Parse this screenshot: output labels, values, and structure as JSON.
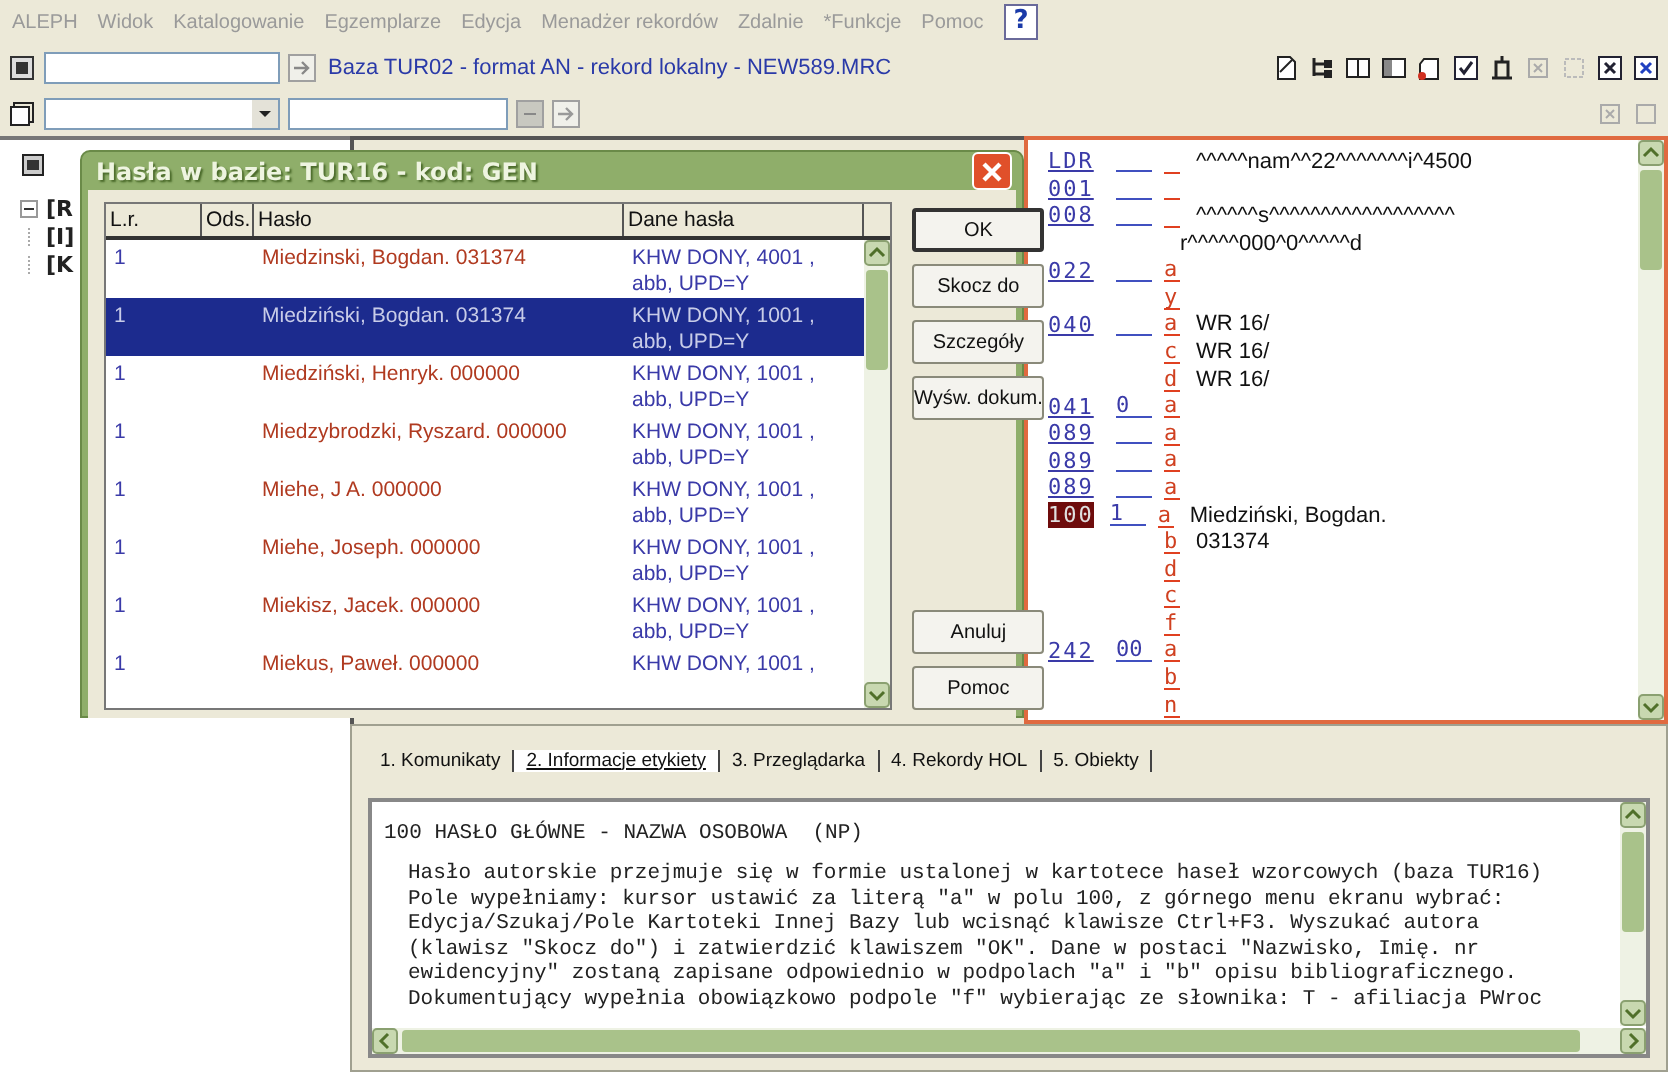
{
  "menu": [
    {
      "label": "ALEPH"
    },
    {
      "label": "Widok"
    },
    {
      "label": "Katalogowanie"
    },
    {
      "label": "Egzemplarze"
    },
    {
      "label": "Edycja"
    },
    {
      "label": "Menadżer rekordów"
    },
    {
      "label": "Zdalnie"
    },
    {
      "label": "*Funkcje"
    },
    {
      "label": "Pomoc"
    }
  ],
  "help_button": "?",
  "toolbar": {
    "title": "Baza TUR02 - format AN - rekord lokalny - NEW589.MRC"
  },
  "tree": {
    "items": [
      {
        "label": "[R",
        "expanded": true
      },
      {
        "label": "[I]",
        "expanded": false
      },
      {
        "label": "[K",
        "expanded": false
      }
    ]
  },
  "dialog": {
    "title": "Hasła w bazie: TUR16 - kod: GEN",
    "columns": [
      "L.r.",
      "Ods.",
      "Hasło",
      "Dane hasła"
    ],
    "rows": [
      {
        "number": "1",
        "heading": "Miedzinski, Bogdan. 031374",
        "data": [
          "KHW DONY, 4001 ,",
          "abb, UPD=Y"
        ],
        "selected": false
      },
      {
        "number": "1",
        "heading": "Miedziński, Bogdan. 031374",
        "data": [
          "KHW DONY, 1001 ,",
          "abb, UPD=Y"
        ],
        "selected": true
      },
      {
        "number": "1",
        "heading": "Miedziński, Henryk. 000000",
        "data": [
          "KHW DONY, 1001 ,",
          "abb, UPD=Y"
        ],
        "selected": false
      },
      {
        "number": "1",
        "heading": "Miedzybrodzki, Ryszard. 000000",
        "data": [
          "KHW DONY, 1001 ,",
          "abb, UPD=Y"
        ],
        "selected": false
      },
      {
        "number": "1",
        "heading": "Miehe, J A. 000000",
        "data": [
          "KHW DONY, 1001 ,",
          "abb, UPD=Y"
        ],
        "selected": false
      },
      {
        "number": "1",
        "heading": "Miehe, Joseph. 000000",
        "data": [
          "KHW DONY, 1001 ,",
          "abb, UPD=Y"
        ],
        "selected": false
      },
      {
        "number": "1",
        "heading": "Miekisz, Jacek. 000000",
        "data": [
          "KHW DONY, 1001 ,",
          "abb, UPD=Y"
        ],
        "selected": false
      },
      {
        "number": "1",
        "heading": "Miekus, Paweł. 000000",
        "data": [
          "KHW DONY, 1001 ,"
        ],
        "selected": false
      }
    ],
    "buttons": [
      "OK",
      "Skocz do",
      "Szczegóły",
      "Wyśw. dokum."
    ],
    "bottom_buttons": [
      "Anuluj",
      "Pomoc"
    ]
  },
  "record": {
    "fields": [
      {
        "tag": "LDR",
        "selected": false,
        "subfields": [
          {
            "text": "^^^^^nam^^22^^^^^^^i^4500"
          }
        ]
      },
      {
        "tag": "001",
        "selected": false
      },
      {
        "tag": "008",
        "selected": false,
        "subfields": [
          {
            "text": "^^^^^^s^^^^^^^^^^^^^^^^^^"
          },
          {
            "text": "r^^^^^000^0^^^^^d",
            "continued": true
          }
        ]
      },
      {
        "tag": "022",
        "selected": false,
        "subfields": [
          {
            "code": "a"
          },
          {
            "code": "y"
          }
        ]
      },
      {
        "tag": "040",
        "selected": false,
        "subfields": [
          {
            "code": "a",
            "text": "WR 16/"
          },
          {
            "code": "c",
            "text": "WR 16/"
          },
          {
            "code": "d",
            "text": "WR 16/"
          }
        ]
      },
      {
        "tag": "041",
        "indicator": "0",
        "selected": false,
        "subfields": [
          {
            "code": "a"
          }
        ]
      },
      {
        "tag": "089",
        "selected": false,
        "subfields": [
          {
            "code": "a"
          }
        ]
      },
      {
        "tag": "089",
        "selected": false,
        "subfields": [
          {
            "code": "a"
          }
        ]
      },
      {
        "tag": "089",
        "selected": false,
        "subfields": [
          {
            "code": "a"
          }
        ]
      },
      {
        "tag": "100",
        "indicator": "1",
        "selected": true,
        "subfields": [
          {
            "code": "a",
            "text": "Miedziński, Bogdan."
          },
          {
            "code": "b",
            "text": "031374"
          },
          {
            "code": "d"
          },
          {
            "code": "c"
          },
          {
            "code": "f"
          }
        ]
      },
      {
        "tag": "242",
        "indicator": "00",
        "selected": false,
        "subfields": [
          {
            "code": "a"
          },
          {
            "code": "b"
          },
          {
            "code": "n"
          }
        ]
      }
    ]
  },
  "info_panel": {
    "tabs": [
      {
        "label": "1. Komunikaty",
        "selected": false
      },
      {
        "label": "2. Informacje etykiety",
        "selected": true
      },
      {
        "label": "3. Przeglądarka",
        "selected": false
      },
      {
        "label": "4. Rekordy HOL",
        "selected": false
      },
      {
        "label": "5. Obiekty",
        "selected": false
      }
    ],
    "heading": "100 HASŁO GŁÓWNE - NAZWA OSOBOWA  (NP)",
    "lines": [
      "Hasło autorskie przejmuje się w formie ustalonej w kartotece haseł wzorcowych (baza TUR16)",
      "Pole wypełniamy: kursor ustawić za literą \"a\" w polu 100, z górnego menu ekranu wybrać:",
      "Edycja/Szukaj/Pole Kartoteki Innej Bazy lub wcisnąć klawisze Ctrl+F3. Wyszukać autora",
      "(klawisz \"Skocz do\") i zatwierdzić klawiszem \"OK\". Dane w postaci \"Nazwisko, Imię. nr",
      "ewidencyjny\" zostaną zapisane odpowiednio w podpolach \"a\" i \"b\" opisu bibliograficznego.",
      "Dokumentujący wypełnia obowiązkowo podpole \"f\" wybierając ze słownika: T - afiliacja PWroc"
    ]
  }
}
